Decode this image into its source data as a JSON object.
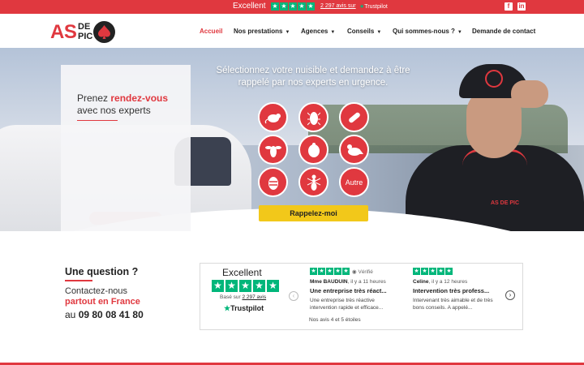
{
  "topbar": {
    "rating_label": "Excellent",
    "review_count": "2 297 avis sur",
    "brand": "Trustpilot",
    "social": [
      "facebook-icon",
      "linkedin-icon"
    ]
  },
  "header": {
    "logo": {
      "as": "AS",
      "de": "DE",
      "pic": "PIC"
    },
    "nav": [
      {
        "label": "Accueil",
        "active": true,
        "dropdown": false
      },
      {
        "label": "Nos prestations",
        "active": false,
        "dropdown": true
      },
      {
        "label": "Agences",
        "active": false,
        "dropdown": true
      },
      {
        "label": "Conseils",
        "active": false,
        "dropdown": true
      },
      {
        "label": "Qui sommes-nous ?",
        "active": false,
        "dropdown": true
      },
      {
        "label": "Demande de contact",
        "active": false,
        "dropdown": false
      }
    ]
  },
  "hero": {
    "panel_prefix": "Prenez",
    "panel_highlight": "rendez-vous",
    "panel_suffix": "avec nos experts",
    "title": "Sélectionnez votre nuisible et demandez à être rappelé par nos experts en urgence.",
    "pests": [
      "rat-icon",
      "cockroach-icon",
      "termite-icon",
      "wasp-icon",
      "bedbug-icon",
      "pigeon-icon",
      "hornet-icon",
      "ant-icon",
      "Autre"
    ],
    "cta": "Rappelez-moi",
    "shirt_logo": "AS DE PIC"
  },
  "question": {
    "title": "Une question ?",
    "line1": "Contactez-nous",
    "line2": "partout en France",
    "phone_prefix": "au",
    "phone": "09 80 08 41 80"
  },
  "trustpilot_widget": {
    "rating_label": "Excellent",
    "based_prefix": "Basé sur",
    "based_count": "2 297 avis",
    "brand": "Trustpilot",
    "verified": "Vérifié",
    "reviews": [
      {
        "author": "Mme BAUDUIN",
        "when": ", il y a 11 heures",
        "title": "Une entreprise très réact...",
        "text": "Une entreprise très réactive intervention rapide et efficace..."
      },
      {
        "author": "Celine",
        "when": ", il y a 12 heures",
        "title": "Intervention très profess...",
        "text": "Intervenant très aimable et de très bons conseils. A appelé..."
      }
    ],
    "footer": "Nos avis 4 et 5 étoiles"
  },
  "colors": {
    "brand": "#e0383f",
    "cta": "#f2c81a",
    "trustpilot": "#00b67a"
  }
}
